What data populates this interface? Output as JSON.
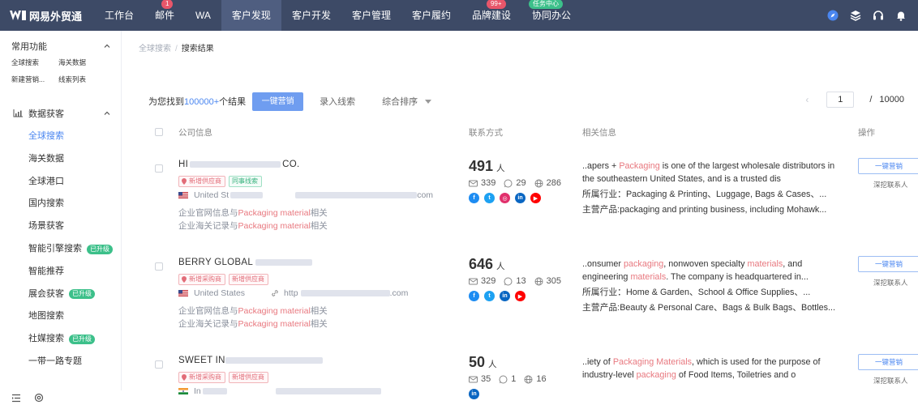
{
  "nav": {
    "brand": "网易外贸通",
    "items": [
      {
        "label": "工作台",
        "badge": "",
        "active": false
      },
      {
        "label": "邮件",
        "badge": "1",
        "active": false
      },
      {
        "label": "WA",
        "badge": "",
        "active": false
      },
      {
        "label": "客户发现",
        "badge": "",
        "active": true
      },
      {
        "label": "客户开发",
        "badge": "",
        "active": false
      },
      {
        "label": "客户管理",
        "badge": "",
        "active": false
      },
      {
        "label": "客户履约",
        "badge": "",
        "active": false
      },
      {
        "label": "品牌建设",
        "badge": "99+",
        "active": false
      },
      {
        "label": "协同办公",
        "badge": "任务中心",
        "active": false
      }
    ]
  },
  "sidebar": {
    "common_title": "常用功能",
    "quick_links": [
      "全球搜索",
      "海关数据",
      "新建营销...",
      "线索列表"
    ],
    "section_title": "数据获客",
    "items": [
      {
        "label": "全球搜索",
        "upgraded": false,
        "active": true
      },
      {
        "label": "海关数据",
        "upgraded": false,
        "active": false
      },
      {
        "label": "全球港口",
        "upgraded": false,
        "active": false
      },
      {
        "label": "国内搜索",
        "upgraded": false,
        "active": false
      },
      {
        "label": "场景获客",
        "upgraded": false,
        "active": false
      },
      {
        "label": "智能引擎搜索",
        "upgraded": true,
        "active": false
      },
      {
        "label": "智能推荐",
        "upgraded": false,
        "active": false
      },
      {
        "label": "展会获客",
        "upgraded": true,
        "active": false
      },
      {
        "label": "地图搜索",
        "upgraded": false,
        "active": false
      },
      {
        "label": "社媒搜索",
        "upgraded": true,
        "active": false
      },
      {
        "label": "一带一路专题",
        "upgraded": false,
        "active": false
      }
    ],
    "upgrade_badge": "已升级"
  },
  "breadcrumb": {
    "parent": "全球搜索",
    "sep": "/",
    "current": "搜索结果"
  },
  "toolbar": {
    "found_prefix": "为您找到",
    "found_count": "100000+",
    "found_suffix": "个结果",
    "marketing_button": "一键营销",
    "add_leads": "录入线索",
    "sort_label": "综合排序",
    "pager_prev": "‹",
    "page": "1",
    "pager_sep": "/",
    "total_pages": "10000"
  },
  "table": {
    "headers": {
      "company": "公司信息",
      "contact": "联系方式",
      "info": "相关信息",
      "ops": "操作"
    }
  },
  "row_labels": {
    "people_unit": "人",
    "industry_label": "所属行业：",
    "product_label": "主营产品:",
    "op_button": "一键营销",
    "op_link": "深挖联系人"
  },
  "rows": [
    {
      "name_visible_start": "HI",
      "name_visible_end": "CO.",
      "tags": [
        {
          "text": "新增供应商",
          "color": "red"
        },
        {
          "text": "同事线索",
          "color": "green"
        }
      ],
      "country": "United St",
      "url_start": "",
      "url_end": "com",
      "flag": "us",
      "desc_web_prefix": "企业官网信息与",
      "desc_web_hl": "Packaging material",
      "desc_web_suffix": "相关",
      "desc_customs_prefix": "企业海关记录与",
      "desc_customs_hl": "Packaging material",
      "desc_customs_suffix": "相关",
      "people": "491",
      "emails": "339",
      "phones": "29",
      "sites": "286",
      "socials": [
        "facebook",
        "twitter",
        "instagram",
        "linkedin",
        "youtube"
      ],
      "info_line1_a": "..apers + ",
      "info_line1_hl": "Packaging",
      "info_line1_b": " is one of the largest wholesale distributors in",
      "info_line2": "the southeastern United States, and is a trusted dis",
      "industry": "Packaging & Printing、Luggage, Bags & Cases、...",
      "product": "packaging and printing business, including Mohawk..."
    },
    {
      "name_visible_start": "BERRY GLOBAL ",
      "name_visible_end": "",
      "tags": [
        {
          "text": "新增采购商",
          "color": "red"
        },
        {
          "text": "新增供应商",
          "color": "red"
        }
      ],
      "country": "United States",
      "url_start": "http",
      "url_end": ".com",
      "flag": "us",
      "desc_web_prefix": "企业官网信息与",
      "desc_web_hl": "Packaging material",
      "desc_web_suffix": "相关",
      "desc_customs_prefix": "企业海关记录与",
      "desc_customs_hl": "Packaging material",
      "desc_customs_suffix": "相关",
      "people": "646",
      "emails": "329",
      "phones": "13",
      "sites": "305",
      "socials": [
        "facebook",
        "twitter",
        "linkedin",
        "youtube"
      ],
      "info_line1_a": "..onsumer ",
      "info_line1_hl": "packaging",
      "info_line1_b": ", nonwoven specialty ",
      "info_line1_hl2": "materials",
      "info_line1_c": ", and",
      "info_line2_a": "engineering ",
      "info_line2_hl": "materials",
      "info_line2_b": ". The company is headquartered in...",
      "industry": "Home & Garden、School & Office Supplies、...",
      "product": "Beauty & Personal Care、Bags & Bulk Bags、Bottles..."
    },
    {
      "name_visible_start": "SWEET IN",
      "name_visible_end": "",
      "tags": [
        {
          "text": "新增采购商",
          "color": "red"
        },
        {
          "text": "新增供应商",
          "color": "red"
        }
      ],
      "country": "In",
      "url_start": "",
      "url_end": "",
      "flag": "in",
      "people": "50",
      "emails": "35",
      "phones": "1",
      "sites": "16",
      "socials": [
        "linkedin"
      ],
      "info_line1_a": "..iety of ",
      "info_line1_hl": "Packaging Materials",
      "info_line1_b": ", which is used for the purpose of",
      "info_line2_a": "industry-level ",
      "info_line2_hl": "packaging",
      "info_line2_b": " of Food Items, Toiletries and o"
    }
  ],
  "colors": {
    "nav_bg": "#3d4a66",
    "nav_active": "#4f5e80",
    "accent": "#4a86f0",
    "highlight": "#e8787f",
    "upgrade": "#3cc08a"
  },
  "icons": [
    "brand-logo-icon",
    "compass-icon",
    "layers-icon",
    "headset-icon",
    "bell-icon",
    "chart-icon",
    "chevron-up-icon",
    "menu-icon",
    "settings-icon",
    "mail-icon",
    "whatsapp-icon",
    "globe-icon",
    "link-icon",
    "pin-icon"
  ]
}
